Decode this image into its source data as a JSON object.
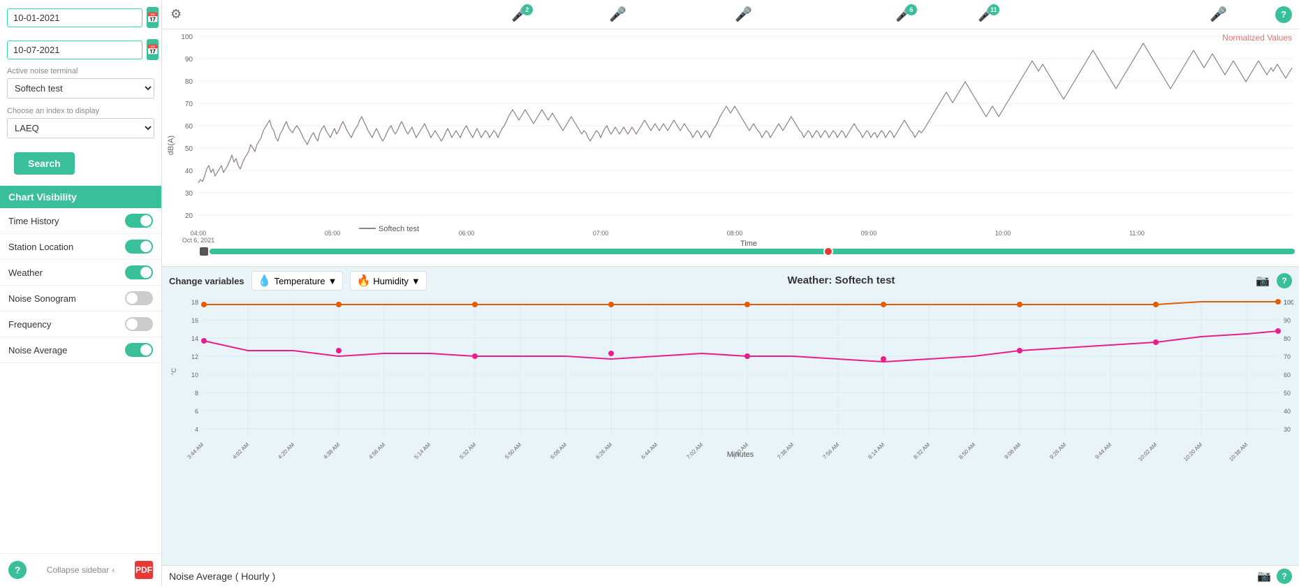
{
  "sidebar": {
    "date_start": "10-01-2021",
    "date_end": "10-07-2021",
    "active_terminal_label": "Active noise terminal",
    "active_terminal_value": "Softech test",
    "index_label": "Choose an index to display",
    "index_value": "LAEQ",
    "search_label": "Search",
    "section_header": "Chart Visibility",
    "toggles": [
      {
        "label": "Time History",
        "on": true
      },
      {
        "label": "Station Location",
        "on": true
      },
      {
        "label": "Weather",
        "on": true
      },
      {
        "label": "Noise Sonogram",
        "on": false
      },
      {
        "label": "Frequency",
        "on": false
      },
      {
        "label": "Noise Average",
        "on": true
      }
    ],
    "collapse_label": "Collapse sidebar",
    "help_label": "?",
    "pdf_label": "PDF"
  },
  "toolbar": {
    "gear_label": "⚙",
    "mic_markers": [
      {
        "id": "mic1",
        "badge": "2",
        "badge_color": "teal",
        "left_pct": 32
      },
      {
        "id": "mic2",
        "badge": null,
        "left_pct": 43
      },
      {
        "id": "mic3",
        "badge": null,
        "left_pct": 57
      },
      {
        "id": "mic4",
        "badge": "6",
        "badge_color": "teal",
        "left_pct": 73
      },
      {
        "id": "mic5",
        "badge": "11",
        "badge_color": "teal",
        "left_pct": 80
      },
      {
        "id": "mic6",
        "badge": null,
        "left_pct": 93
      }
    ],
    "help_label": "?"
  },
  "time_history": {
    "y_axis": [
      "100",
      "90",
      "80",
      "70",
      "60",
      "50",
      "40",
      "30",
      "20"
    ],
    "y_label": "dB(A)",
    "x_labels": [
      "04:00\nOct 6, 2021",
      "05:00",
      "06:00",
      "07:00",
      "08:00",
      "09:00",
      "10:00",
      "11:00"
    ],
    "time_label": "Time",
    "normalized_label": "Normalized Values",
    "legend_line": "Softech test"
  },
  "weather": {
    "change_variables_label": "Change variables",
    "temperature_label": "Temperature",
    "humidity_label": "Humidity",
    "title": "Weather: Softech test",
    "x_label": "Minutes",
    "x_ticks": [
      "3:44 AM",
      "4:02 AM",
      "4:20 AM",
      "4:38 AM",
      "4:56 AM",
      "5:14 AM",
      "5:32 AM",
      "5:50 AM",
      "6:08 AM",
      "6:26 AM",
      "6:44 AM",
      "7:02 AM",
      "7:20 AM",
      "7:38 AM",
      "7:56 AM",
      "8:14 AM",
      "8:32 AM",
      "8:50 AM",
      "9:08 AM",
      "9:26 AM",
      "9:44 AM",
      "10:02 AM",
      "10:20 AM",
      "10:38 AM"
    ],
    "y_left_max": 18,
    "y_right_max": 100,
    "camera_label": "📷",
    "help_label": "?"
  },
  "noise_avg": {
    "title": "Noise Average ( Hourly )",
    "camera_label": "📷",
    "help_label": "?"
  }
}
